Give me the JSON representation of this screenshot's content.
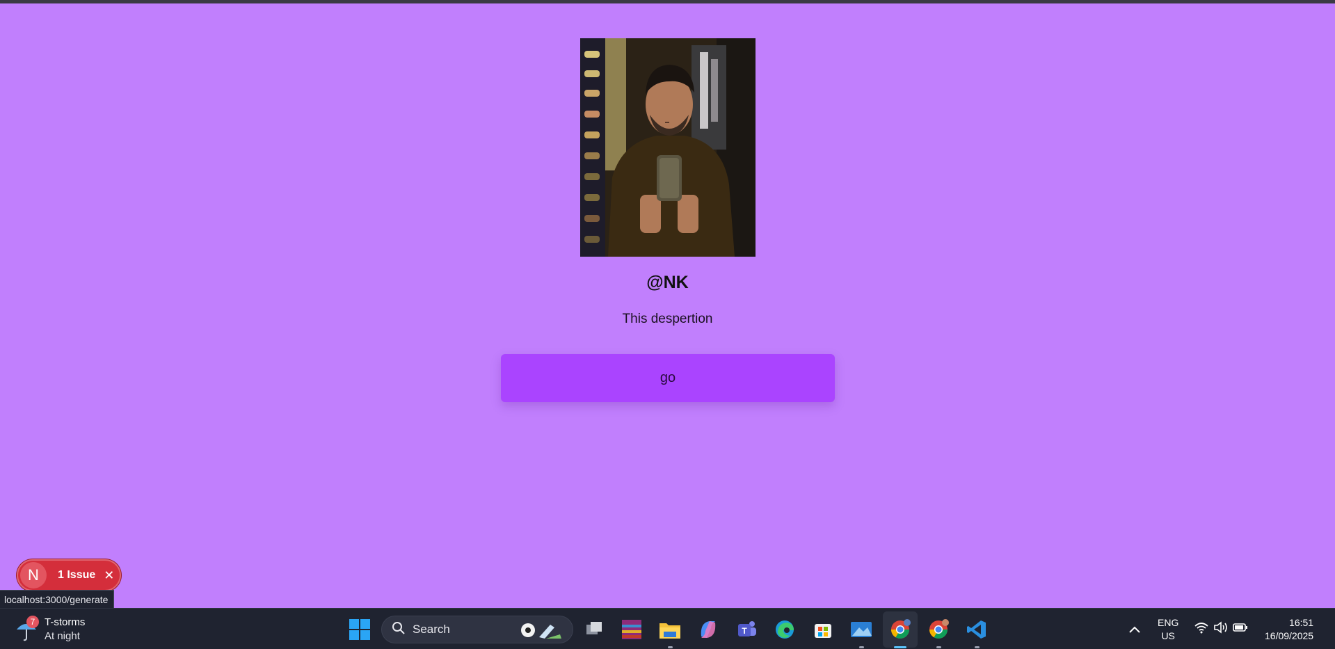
{
  "profile": {
    "handle": "@NK",
    "bio": "This despertion",
    "go_label": "go"
  },
  "devtools": {
    "issue_badge_letter": "N",
    "issue_label": "1 Issue",
    "close_glyph": "✕"
  },
  "status_bar": {
    "url": "localhost:3000/generate"
  },
  "taskbar": {
    "weather": {
      "badge": "7",
      "title": "T-storms",
      "subtitle": "At night"
    },
    "search": {
      "label": "Search"
    },
    "apps": [
      "task-view",
      "winrar",
      "file-explorer",
      "copilot",
      "teams",
      "edge",
      "microsoft-store",
      "photos",
      "chrome",
      "chrome-profile",
      "vscode"
    ],
    "tray": {
      "chevron": "^",
      "lang_top": "ENG",
      "lang_bottom": "US",
      "time": "16:51",
      "date": "16/09/2025"
    }
  },
  "colors": {
    "page_background": "#c17ffd",
    "button_background": "#aa44ff",
    "issue_pill": "#d42e3b",
    "taskbar": "#1f2330"
  }
}
